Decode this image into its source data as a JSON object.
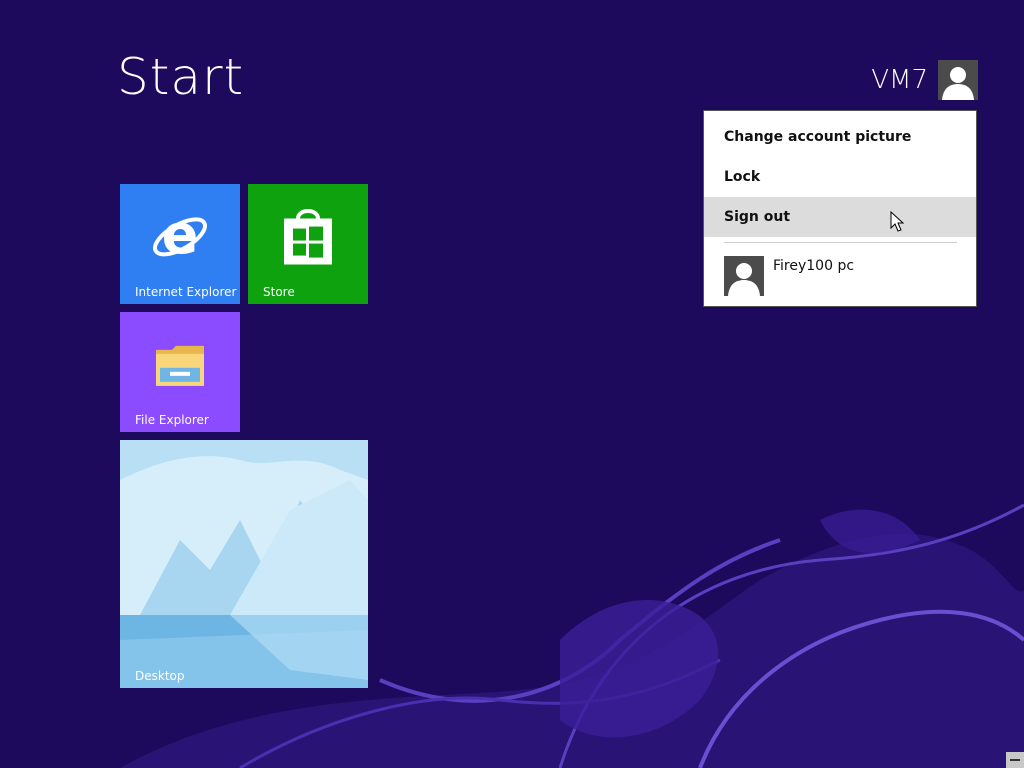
{
  "start": {
    "title": "Start"
  },
  "user": {
    "name": "VM7"
  },
  "tiles": [
    {
      "label": "Internet Explorer",
      "icon": "internet-explorer-icon",
      "color": "#2f7ef2"
    },
    {
      "label": "Store",
      "icon": "store-icon",
      "color": "#0ea30e"
    },
    {
      "label": "File Explorer",
      "icon": "file-explorer-icon",
      "color": "#8b4cff"
    },
    {
      "label": "Desktop",
      "icon": "desktop-wallpaper",
      "color": "#7ec3ea"
    }
  ],
  "account_menu": {
    "items": [
      {
        "label": "Change account picture"
      },
      {
        "label": "Lock"
      },
      {
        "label": "Sign out"
      }
    ],
    "other_account": {
      "name": "Firey100 pc"
    }
  },
  "colors": {
    "background": "#1e0a5c",
    "accent_swirl": "#5a3fc0"
  }
}
